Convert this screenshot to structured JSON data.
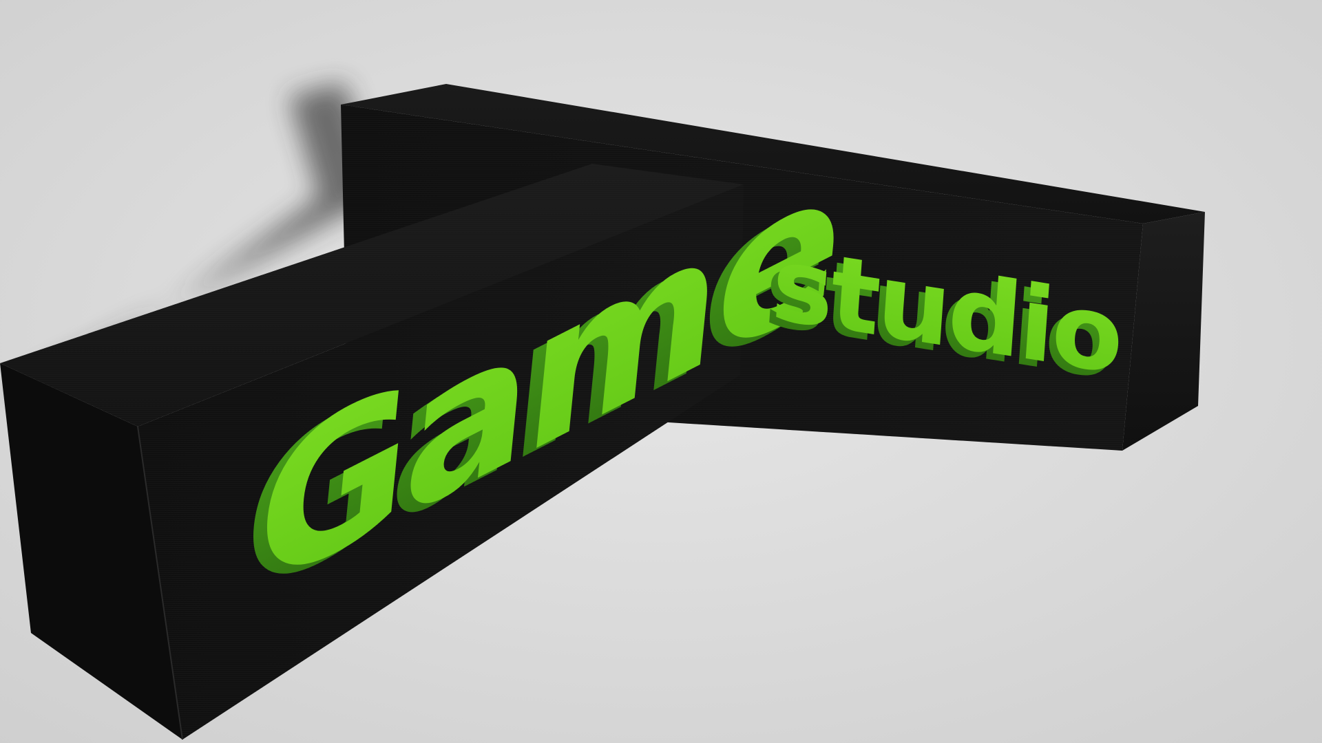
{
  "logo": {
    "word_primary": "Game",
    "word_secondary": "studio",
    "colors": {
      "background": "#d8d8d8",
      "block": "#151515",
      "text_green": "#6fcf1c",
      "text_green_dark": "#3f8f10"
    }
  }
}
